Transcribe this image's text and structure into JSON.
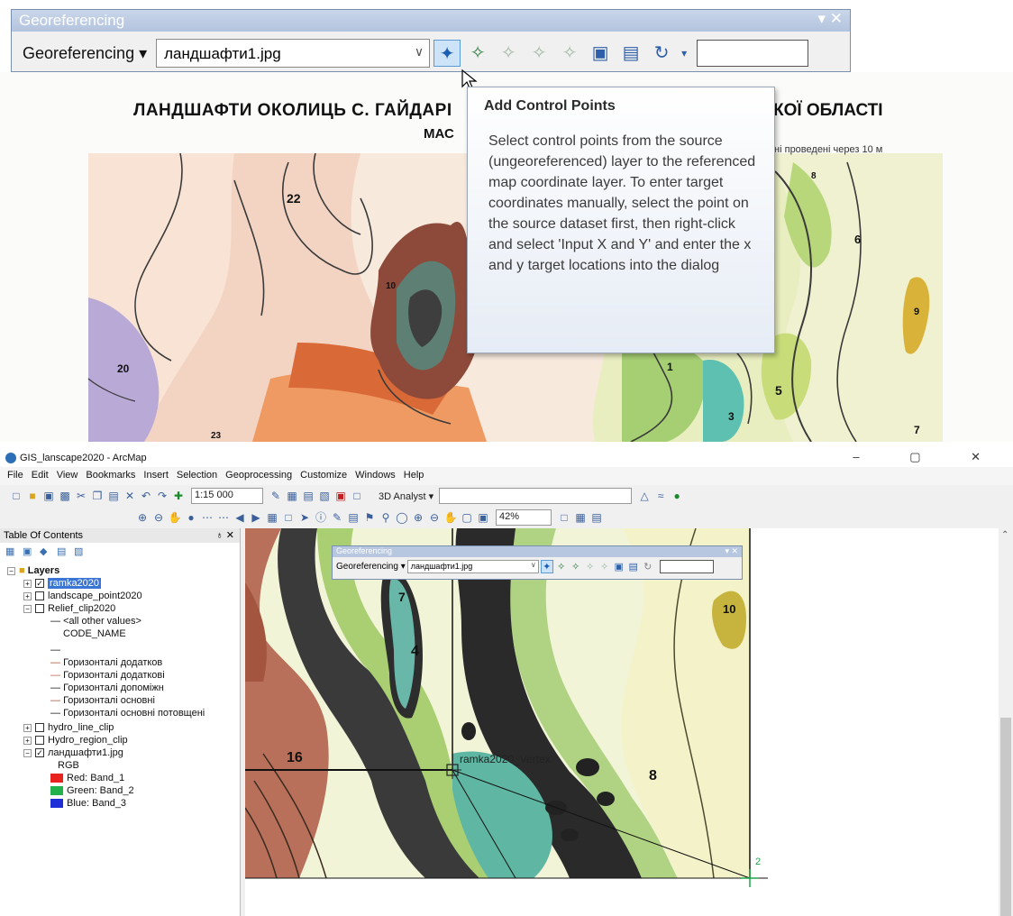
{
  "zoom": {
    "toolbar_title": "Georeferencing",
    "dropdown_label": "Georeferencing ▾",
    "layer_combo": "ландшафти1.jpg",
    "window_controls": "▾ ✕"
  },
  "sheet": {
    "title_left": "ЛАНДШАФТИ ОКОЛИЦЬ С. ГАЙДАРІ",
    "title_right": "КОЇ ОБЛАСТІ",
    "subtitle": "МАС",
    "note": "тані проведені через 10 м",
    "numbers": [
      "22",
      "10",
      "20",
      "6",
      "5",
      "3",
      "1",
      "9",
      "7",
      "23",
      "8"
    ]
  },
  "tooltip": {
    "title": "Add Control Points",
    "body": "Select control points from the source (ungeoreferenced) layer to the referenced map coordinate layer. To enter target coordinates manually, select the point on the source dataset first, then right-click and select 'Input X and Y' and enter the x and y target locations into the dialog"
  },
  "app": {
    "title": "GIS_lanscape2020 - ArcMap",
    "window_controls": "– ▢ ✕",
    "menu": [
      "File",
      "Edit",
      "View",
      "Bookmarks",
      "Insert",
      "Selection",
      "Geoprocessing",
      "Customize",
      "Windows",
      "Help"
    ],
    "scale": "1:15 000",
    "analyst_label": "3D Analyst ▾",
    "zoom_pct": "42%"
  },
  "toc": {
    "title": "Table Of Contents",
    "pin": "♁ ✕",
    "layers_label": "Layers",
    "items": [
      "ramka2020",
      "landscape_point2020",
      "Relief_clip2020",
      "<all other values>",
      "CODE_NAME",
      "Горизонталі додатков",
      "Горизонталі додаткові",
      "Горизонталі допоміжн",
      "Горизонталі основні",
      "Горизонталі основні потовщені",
      "hydro_line_clip",
      "Hydro_region_clip",
      "ландшафти1.jpg",
      "RGB",
      "Red:   Band_1",
      "Green: Band_2",
      "Blue:  Band_3"
    ],
    "band_colors": {
      "red": "#e8221e",
      "green": "#22b14c",
      "blue": "#1f2fd8"
    }
  },
  "small_georef": {
    "title": "Georeferencing",
    "dropdown_label": "Georeferencing ▾",
    "layer_combo": "ландшафти1.jpg"
  },
  "map": {
    "vertex_label": "ramka2020_Vertex",
    "numbers": [
      "4",
      "16",
      "8",
      "2",
      "10",
      "7"
    ]
  }
}
